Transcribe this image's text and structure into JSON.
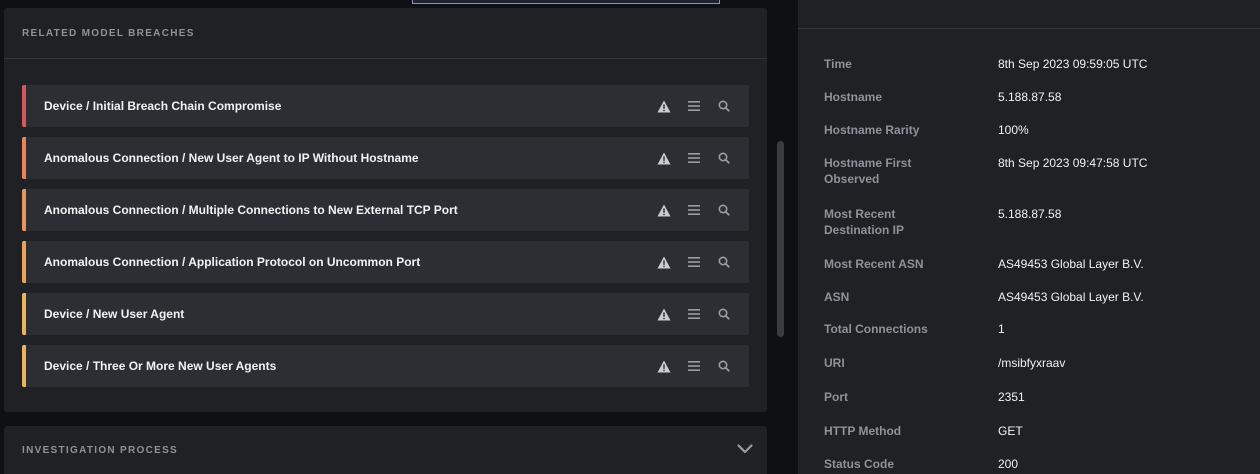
{
  "related_breaches": {
    "title": "RELATED MODEL BREACHES",
    "items": [
      {
        "name": "Device / Initial Breach Chain Compromise",
        "color": "#d5585a"
      },
      {
        "name": "Anomalous Connection / New User Agent to IP Without Hostname",
        "color": "#e8865a"
      },
      {
        "name": "Anomalous Connection / Multiple Connections to New External TCP Port",
        "color": "#e8945a"
      },
      {
        "name": "Anomalous Connection / Application Protocol on Uncommon Port",
        "color": "#eaa35a"
      },
      {
        "name": "Device / New User Agent",
        "color": "#e8b45c"
      },
      {
        "name": "Device / Three Or More New User Agents",
        "color": "#e8b45c"
      }
    ],
    "action_icons": [
      "warning-icon",
      "list-icon",
      "search-icon"
    ]
  },
  "investigation": {
    "title": "INVESTIGATION PROCESS",
    "icon": "chevron-down-icon"
  },
  "details": [
    {
      "label": "Time",
      "value": "8th Sep 2023 09:59:05 UTC"
    },
    {
      "label": "Hostname",
      "value": "5.188.87.58"
    },
    {
      "label": "Hostname Rarity",
      "value": "100%"
    },
    {
      "label": "Hostname First",
      "label2": "Observed",
      "value": "8th Sep 2023 09:47:58 UTC"
    },
    {
      "label": "Most Recent",
      "label2": "Destination IP",
      "value": "5.188.87.58"
    },
    {
      "label": "Most Recent ASN",
      "value": "AS49453 Global Layer B.V."
    },
    {
      "label": "ASN",
      "value": "AS49453 Global Layer B.V."
    },
    {
      "label": "Total Connections",
      "value": "1"
    },
    {
      "label": "URI",
      "value": "/msibfyxraav"
    },
    {
      "label": "Port",
      "value": "2351"
    },
    {
      "label": "HTTP Method",
      "value": "GET"
    },
    {
      "label": "Status Code",
      "value": "200"
    }
  ]
}
